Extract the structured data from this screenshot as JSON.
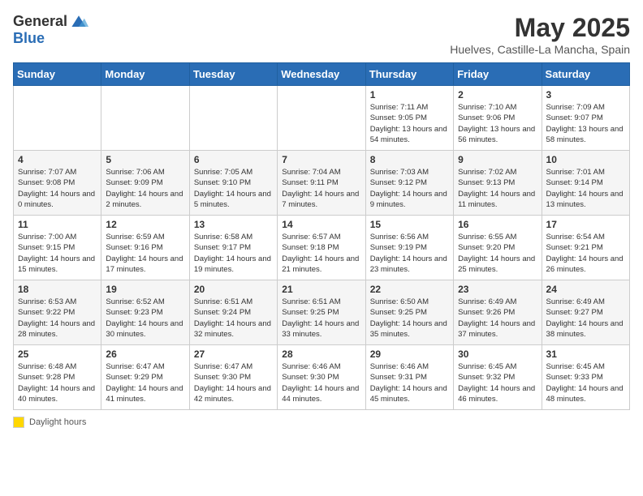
{
  "header": {
    "logo_general": "General",
    "logo_blue": "Blue",
    "month_title": "May 2025",
    "subtitle": "Huelves, Castille-La Mancha, Spain"
  },
  "weekdays": [
    "Sunday",
    "Monday",
    "Tuesday",
    "Wednesday",
    "Thursday",
    "Friday",
    "Saturday"
  ],
  "weeks": [
    [
      {
        "day": "",
        "info": ""
      },
      {
        "day": "",
        "info": ""
      },
      {
        "day": "",
        "info": ""
      },
      {
        "day": "",
        "info": ""
      },
      {
        "day": "1",
        "info": "Sunrise: 7:11 AM\nSunset: 9:05 PM\nDaylight: 13 hours and 54 minutes."
      },
      {
        "day": "2",
        "info": "Sunrise: 7:10 AM\nSunset: 9:06 PM\nDaylight: 13 hours and 56 minutes."
      },
      {
        "day": "3",
        "info": "Sunrise: 7:09 AM\nSunset: 9:07 PM\nDaylight: 13 hours and 58 minutes."
      }
    ],
    [
      {
        "day": "4",
        "info": "Sunrise: 7:07 AM\nSunset: 9:08 PM\nDaylight: 14 hours and 0 minutes."
      },
      {
        "day": "5",
        "info": "Sunrise: 7:06 AM\nSunset: 9:09 PM\nDaylight: 14 hours and 2 minutes."
      },
      {
        "day": "6",
        "info": "Sunrise: 7:05 AM\nSunset: 9:10 PM\nDaylight: 14 hours and 5 minutes."
      },
      {
        "day": "7",
        "info": "Sunrise: 7:04 AM\nSunset: 9:11 PM\nDaylight: 14 hours and 7 minutes."
      },
      {
        "day": "8",
        "info": "Sunrise: 7:03 AM\nSunset: 9:12 PM\nDaylight: 14 hours and 9 minutes."
      },
      {
        "day": "9",
        "info": "Sunrise: 7:02 AM\nSunset: 9:13 PM\nDaylight: 14 hours and 11 minutes."
      },
      {
        "day": "10",
        "info": "Sunrise: 7:01 AM\nSunset: 9:14 PM\nDaylight: 14 hours and 13 minutes."
      }
    ],
    [
      {
        "day": "11",
        "info": "Sunrise: 7:00 AM\nSunset: 9:15 PM\nDaylight: 14 hours and 15 minutes."
      },
      {
        "day": "12",
        "info": "Sunrise: 6:59 AM\nSunset: 9:16 PM\nDaylight: 14 hours and 17 minutes."
      },
      {
        "day": "13",
        "info": "Sunrise: 6:58 AM\nSunset: 9:17 PM\nDaylight: 14 hours and 19 minutes."
      },
      {
        "day": "14",
        "info": "Sunrise: 6:57 AM\nSunset: 9:18 PM\nDaylight: 14 hours and 21 minutes."
      },
      {
        "day": "15",
        "info": "Sunrise: 6:56 AM\nSunset: 9:19 PM\nDaylight: 14 hours and 23 minutes."
      },
      {
        "day": "16",
        "info": "Sunrise: 6:55 AM\nSunset: 9:20 PM\nDaylight: 14 hours and 25 minutes."
      },
      {
        "day": "17",
        "info": "Sunrise: 6:54 AM\nSunset: 9:21 PM\nDaylight: 14 hours and 26 minutes."
      }
    ],
    [
      {
        "day": "18",
        "info": "Sunrise: 6:53 AM\nSunset: 9:22 PM\nDaylight: 14 hours and 28 minutes."
      },
      {
        "day": "19",
        "info": "Sunrise: 6:52 AM\nSunset: 9:23 PM\nDaylight: 14 hours and 30 minutes."
      },
      {
        "day": "20",
        "info": "Sunrise: 6:51 AM\nSunset: 9:24 PM\nDaylight: 14 hours and 32 minutes."
      },
      {
        "day": "21",
        "info": "Sunrise: 6:51 AM\nSunset: 9:25 PM\nDaylight: 14 hours and 33 minutes."
      },
      {
        "day": "22",
        "info": "Sunrise: 6:50 AM\nSunset: 9:25 PM\nDaylight: 14 hours and 35 minutes."
      },
      {
        "day": "23",
        "info": "Sunrise: 6:49 AM\nSunset: 9:26 PM\nDaylight: 14 hours and 37 minutes."
      },
      {
        "day": "24",
        "info": "Sunrise: 6:49 AM\nSunset: 9:27 PM\nDaylight: 14 hours and 38 minutes."
      }
    ],
    [
      {
        "day": "25",
        "info": "Sunrise: 6:48 AM\nSunset: 9:28 PM\nDaylight: 14 hours and 40 minutes."
      },
      {
        "day": "26",
        "info": "Sunrise: 6:47 AM\nSunset: 9:29 PM\nDaylight: 14 hours and 41 minutes."
      },
      {
        "day": "27",
        "info": "Sunrise: 6:47 AM\nSunset: 9:30 PM\nDaylight: 14 hours and 42 minutes."
      },
      {
        "day": "28",
        "info": "Sunrise: 6:46 AM\nSunset: 9:30 PM\nDaylight: 14 hours and 44 minutes."
      },
      {
        "day": "29",
        "info": "Sunrise: 6:46 AM\nSunset: 9:31 PM\nDaylight: 14 hours and 45 minutes."
      },
      {
        "day": "30",
        "info": "Sunrise: 6:45 AM\nSunset: 9:32 PM\nDaylight: 14 hours and 46 minutes."
      },
      {
        "day": "31",
        "info": "Sunrise: 6:45 AM\nSunset: 9:33 PM\nDaylight: 14 hours and 48 minutes."
      }
    ]
  ],
  "footer": {
    "daylight_label": "Daylight hours"
  }
}
